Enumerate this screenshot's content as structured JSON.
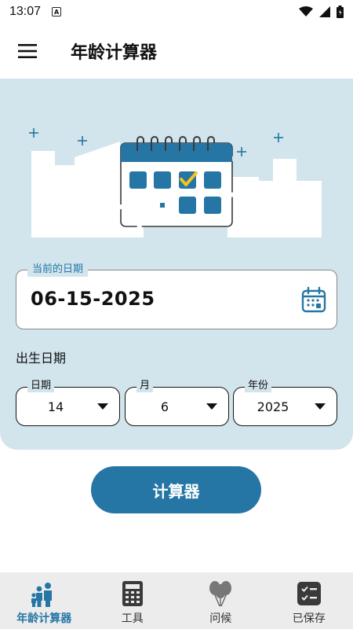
{
  "status_bar": {
    "time": "13:07",
    "notification_icon_label": "A",
    "icons": [
      "wifi-icon",
      "signal-icon",
      "battery-icon"
    ]
  },
  "app_bar": {
    "title": "年龄计算器",
    "menu_icon": "menu-icon"
  },
  "current_date": {
    "label": "当前的日期",
    "value": "06-15-2025",
    "icon": "calendar-icon"
  },
  "birth_date": {
    "label": "出生日期",
    "day": {
      "label": "日期",
      "value": "14"
    },
    "month": {
      "label": "月",
      "value": "6"
    },
    "year": {
      "label": "年份",
      "value": "2025"
    }
  },
  "calculate_button": {
    "label": "计算器"
  },
  "bottom_nav": {
    "items": [
      {
        "label": "年龄计算器",
        "icon": "family-icon",
        "active": true
      },
      {
        "label": "工具",
        "icon": "calculator-icon",
        "active": false
      },
      {
        "label": "问候",
        "icon": "balloons-icon",
        "active": false
      },
      {
        "label": "已保存",
        "icon": "checklist-icon",
        "active": false
      }
    ]
  },
  "colors": {
    "accent": "#2576a5",
    "panel_background": "#d2e4ec",
    "nav_background": "#ececec"
  }
}
